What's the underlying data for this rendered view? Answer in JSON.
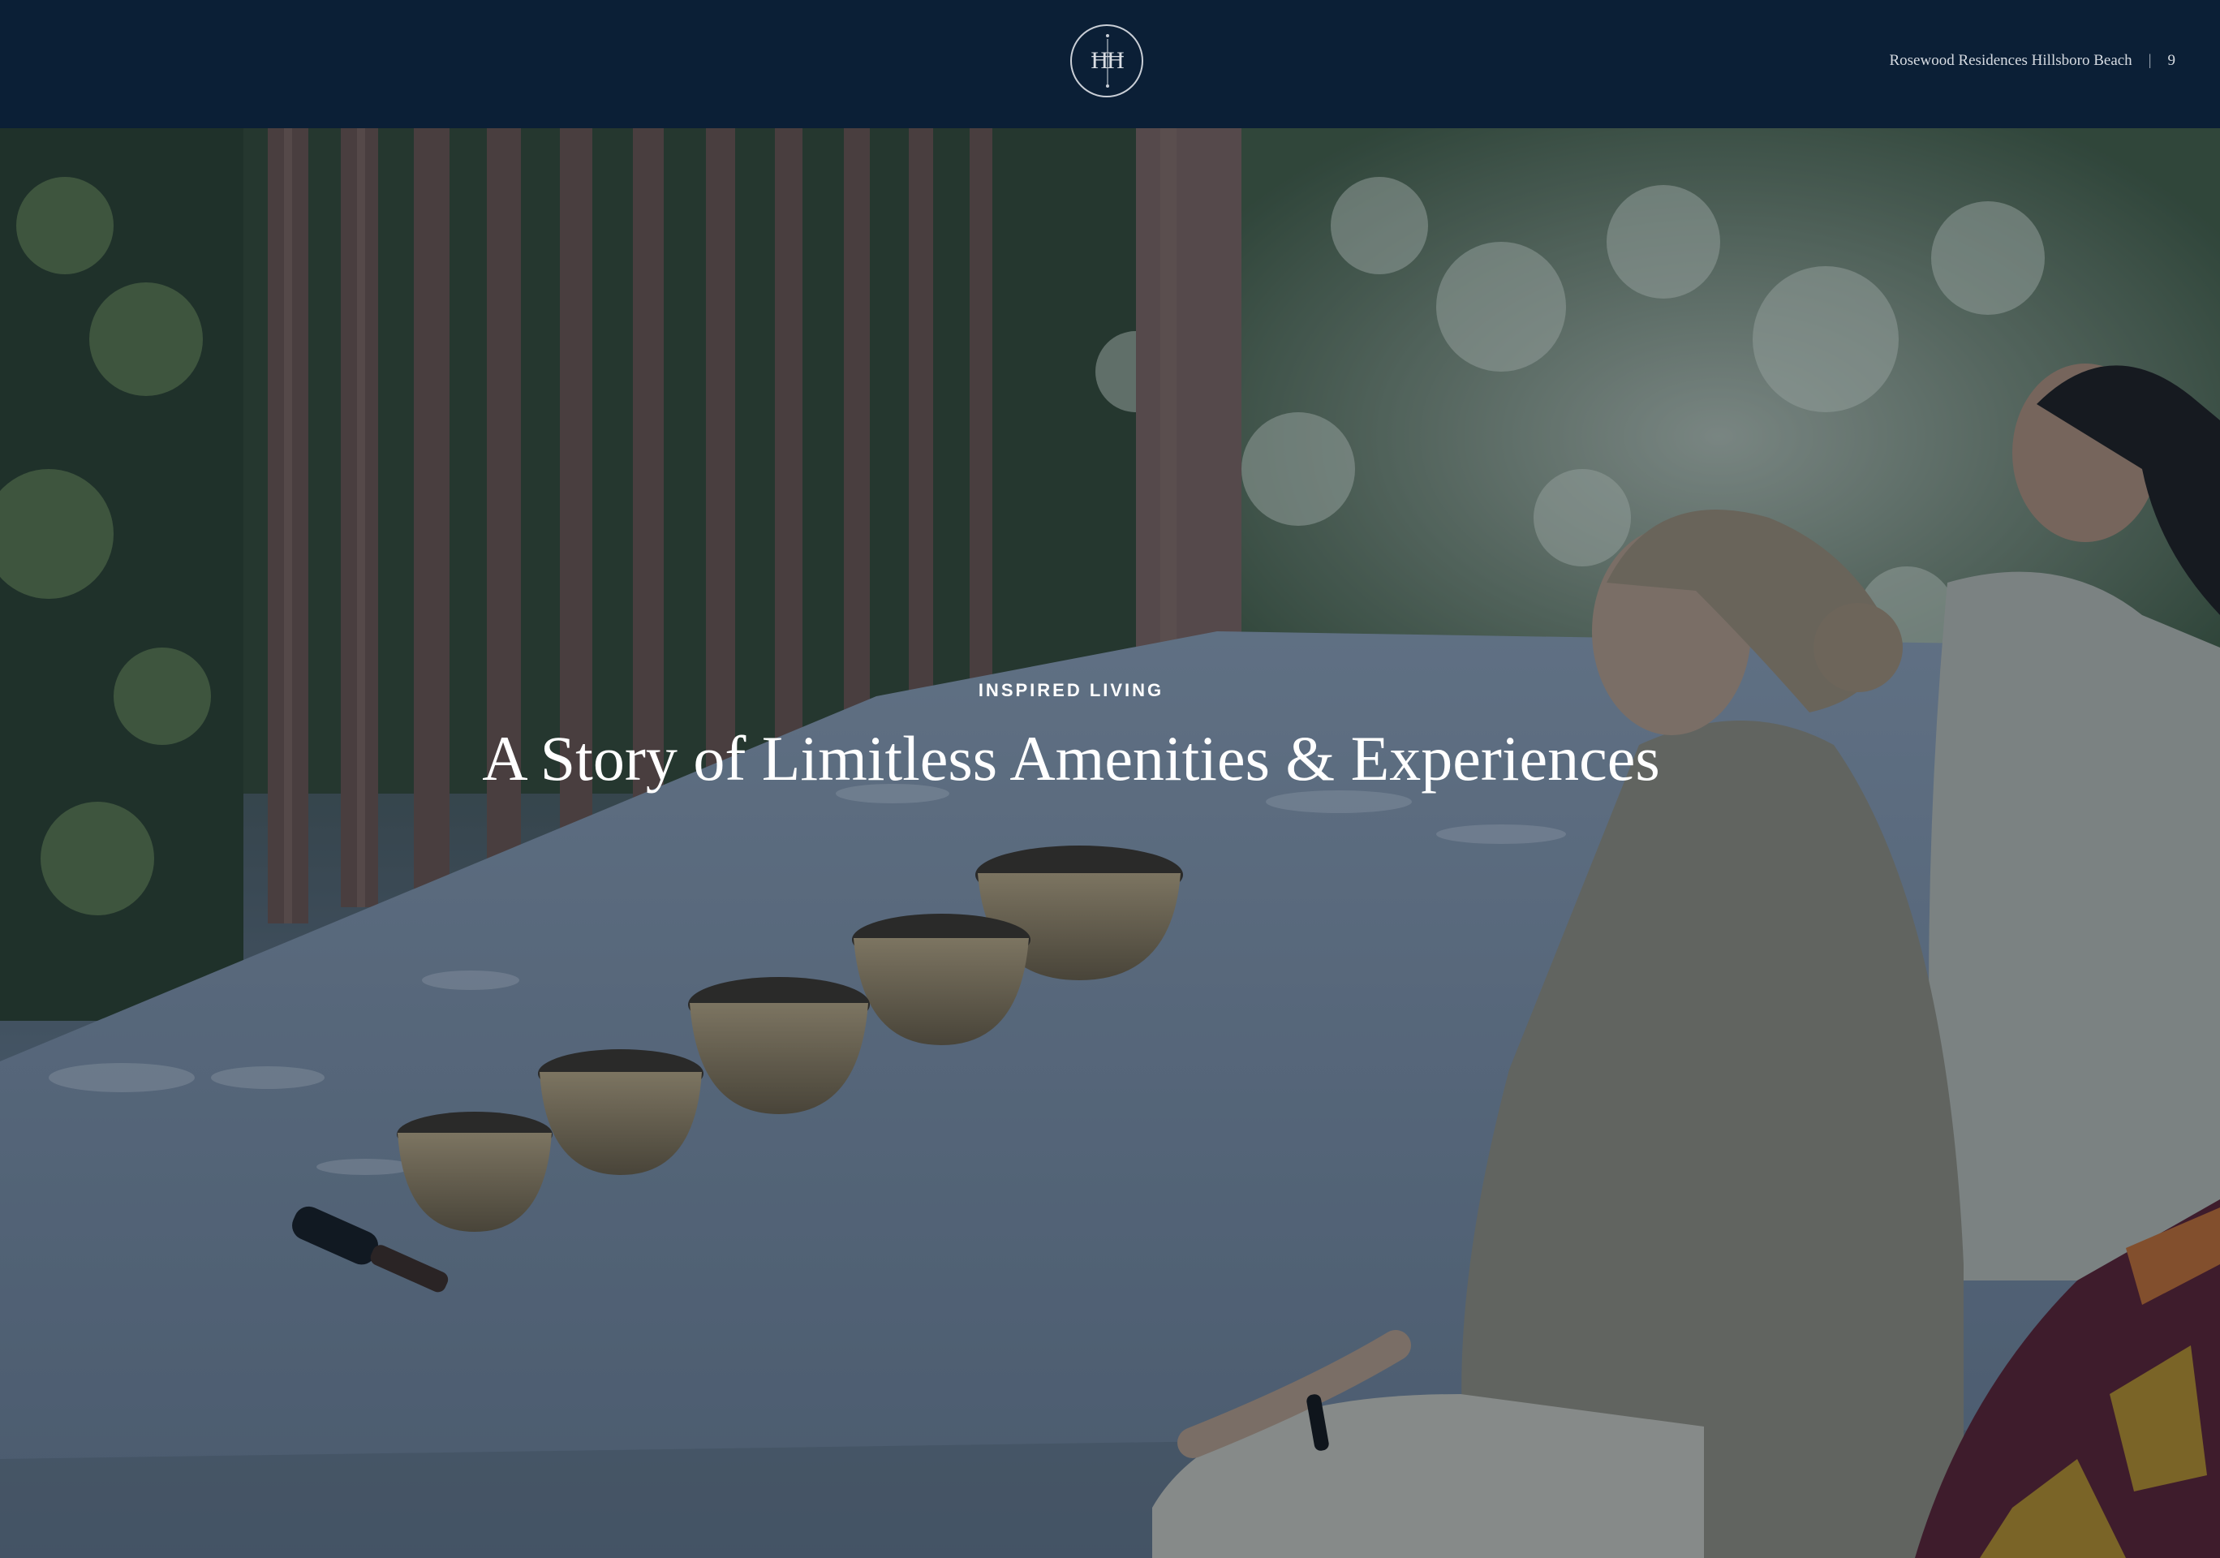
{
  "header": {
    "logo_monogram": "ĦĦ",
    "publication": "Rosewood Residences Hillsboro Beach",
    "separator": "|",
    "page_number": "9",
    "background_color": "#0b1f36"
  },
  "hero": {
    "eyebrow": "INSPIRED LIVING",
    "headline": "A Story of Limitless Amenities & Experiences",
    "text_color": "#ffffff",
    "image_subject": "Two women meditating on a white platform beside a row of brass singing bowls, tropical garden and wooden slats behind"
  }
}
